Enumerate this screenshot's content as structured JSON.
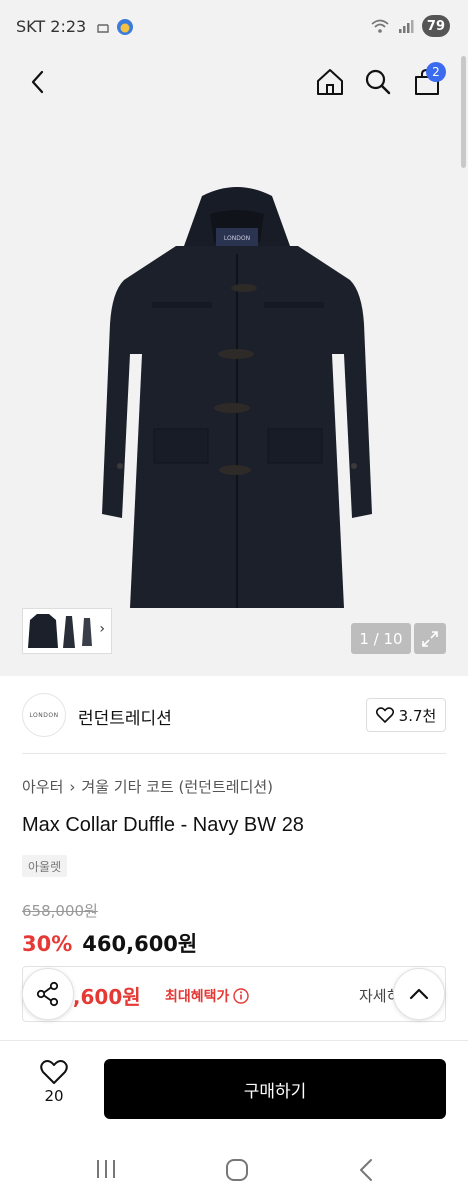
{
  "status_bar": {
    "time": "SKT 2:23",
    "battery": "79"
  },
  "gallery": {
    "counter": "1 / 10",
    "cart_badge": "2"
  },
  "brand": {
    "logo_text": "LONDON",
    "name": "런던트레디션",
    "likes": "3.7천"
  },
  "breadcrumb": {
    "items": [
      "아우터",
      "겨울 기타 코트 (런던트레디션)"
    ]
  },
  "product": {
    "title": "Max Collar Duffle - Navy BW 28",
    "tag": "아울렛",
    "original_price": "658,000원",
    "discount": "30%",
    "sale_price": "460,600원"
  },
  "benefit": {
    "price": "0,600원",
    "label": "최대혜택가",
    "detail": "자세히"
  },
  "bottom_bar": {
    "wish_count": "20",
    "buy_label": "구매하기"
  },
  "colors": {
    "accent_red": "#e53935",
    "badge_blue": "#3b6cf0",
    "buy_button": "#000000"
  }
}
